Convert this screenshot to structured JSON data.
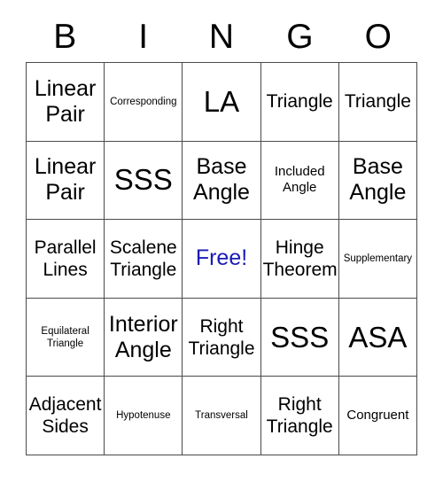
{
  "header": {
    "letters": [
      "B",
      "I",
      "N",
      "G",
      "O"
    ]
  },
  "grid": {
    "free_color": "#1a1ab4",
    "border_color": "#4a4a4a",
    "rows": [
      [
        {
          "label": "Linear\nPair",
          "size": "lg",
          "free": false
        },
        {
          "label": "Corresponding",
          "size": "xs",
          "free": false
        },
        {
          "label": "LA",
          "size": "xl",
          "free": false
        },
        {
          "label": "Triangle",
          "size": "md",
          "free": false
        },
        {
          "label": "Triangle",
          "size": "md",
          "free": false
        }
      ],
      [
        {
          "label": "Linear\nPair",
          "size": "lg",
          "free": false
        },
        {
          "label": "SSS",
          "size": "xl",
          "free": false
        },
        {
          "label": "Base\nAngle",
          "size": "lg",
          "free": false
        },
        {
          "label": "Included\nAngle",
          "size": "sm",
          "free": false
        },
        {
          "label": "Base\nAngle",
          "size": "lg",
          "free": false
        }
      ],
      [
        {
          "label": "Parallel\nLines",
          "size": "md",
          "free": false
        },
        {
          "label": "Scalene\nTriangle",
          "size": "md",
          "free": false
        },
        {
          "label": "Free!",
          "size": "lg",
          "free": true
        },
        {
          "label": "Hinge\nTheorem",
          "size": "md",
          "free": false
        },
        {
          "label": "Supplementary",
          "size": "xs",
          "free": false
        }
      ],
      [
        {
          "label": "Equilateral\nTriangle",
          "size": "xs",
          "free": false
        },
        {
          "label": "Interior\nAngle",
          "size": "lg",
          "free": false
        },
        {
          "label": "Right\nTriangle",
          "size": "md",
          "free": false
        },
        {
          "label": "SSS",
          "size": "xl",
          "free": false
        },
        {
          "label": "ASA",
          "size": "xl",
          "free": false
        }
      ],
      [
        {
          "label": "Adjacent\nSides",
          "size": "md",
          "free": false
        },
        {
          "label": "Hypotenuse",
          "size": "xs",
          "free": false
        },
        {
          "label": "Transversal",
          "size": "xs",
          "free": false
        },
        {
          "label": "Right\nTriangle",
          "size": "md",
          "free": false
        },
        {
          "label": "Congruent",
          "size": "sm",
          "free": false
        }
      ]
    ]
  }
}
